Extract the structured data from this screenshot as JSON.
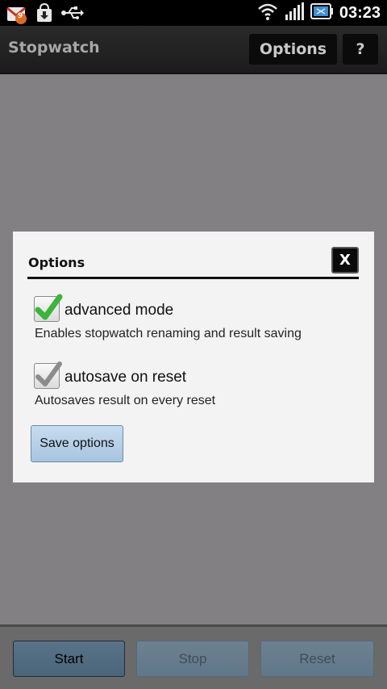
{
  "statusbar": {
    "notification_count": "9",
    "time": "03:23",
    "icons": [
      "gmail-notification-icon",
      "market-download-icon",
      "usb-icon",
      "wifi-icon",
      "signal-icon",
      "battery-icon"
    ]
  },
  "appbar": {
    "title": "Stopwatch",
    "options_label": "Options",
    "help_label": "?"
  },
  "dialog": {
    "title": "Options",
    "close_label": "X",
    "options": [
      {
        "label": "advanced mode",
        "description": "Enables stopwatch renaming and result saving",
        "checked": true
      },
      {
        "label": "autosave on reset",
        "description": "Autosaves result on every reset",
        "checked": true
      }
    ],
    "save_label": "Save options"
  },
  "bottombar": {
    "start_label": "Start",
    "stop_label": "Stop",
    "reset_label": "Reset"
  },
  "colors": {
    "check_green": "#3cb43c",
    "check_gray": "#8c8c8c",
    "overlay": "#828083",
    "save_button": "#b7d0e8"
  }
}
